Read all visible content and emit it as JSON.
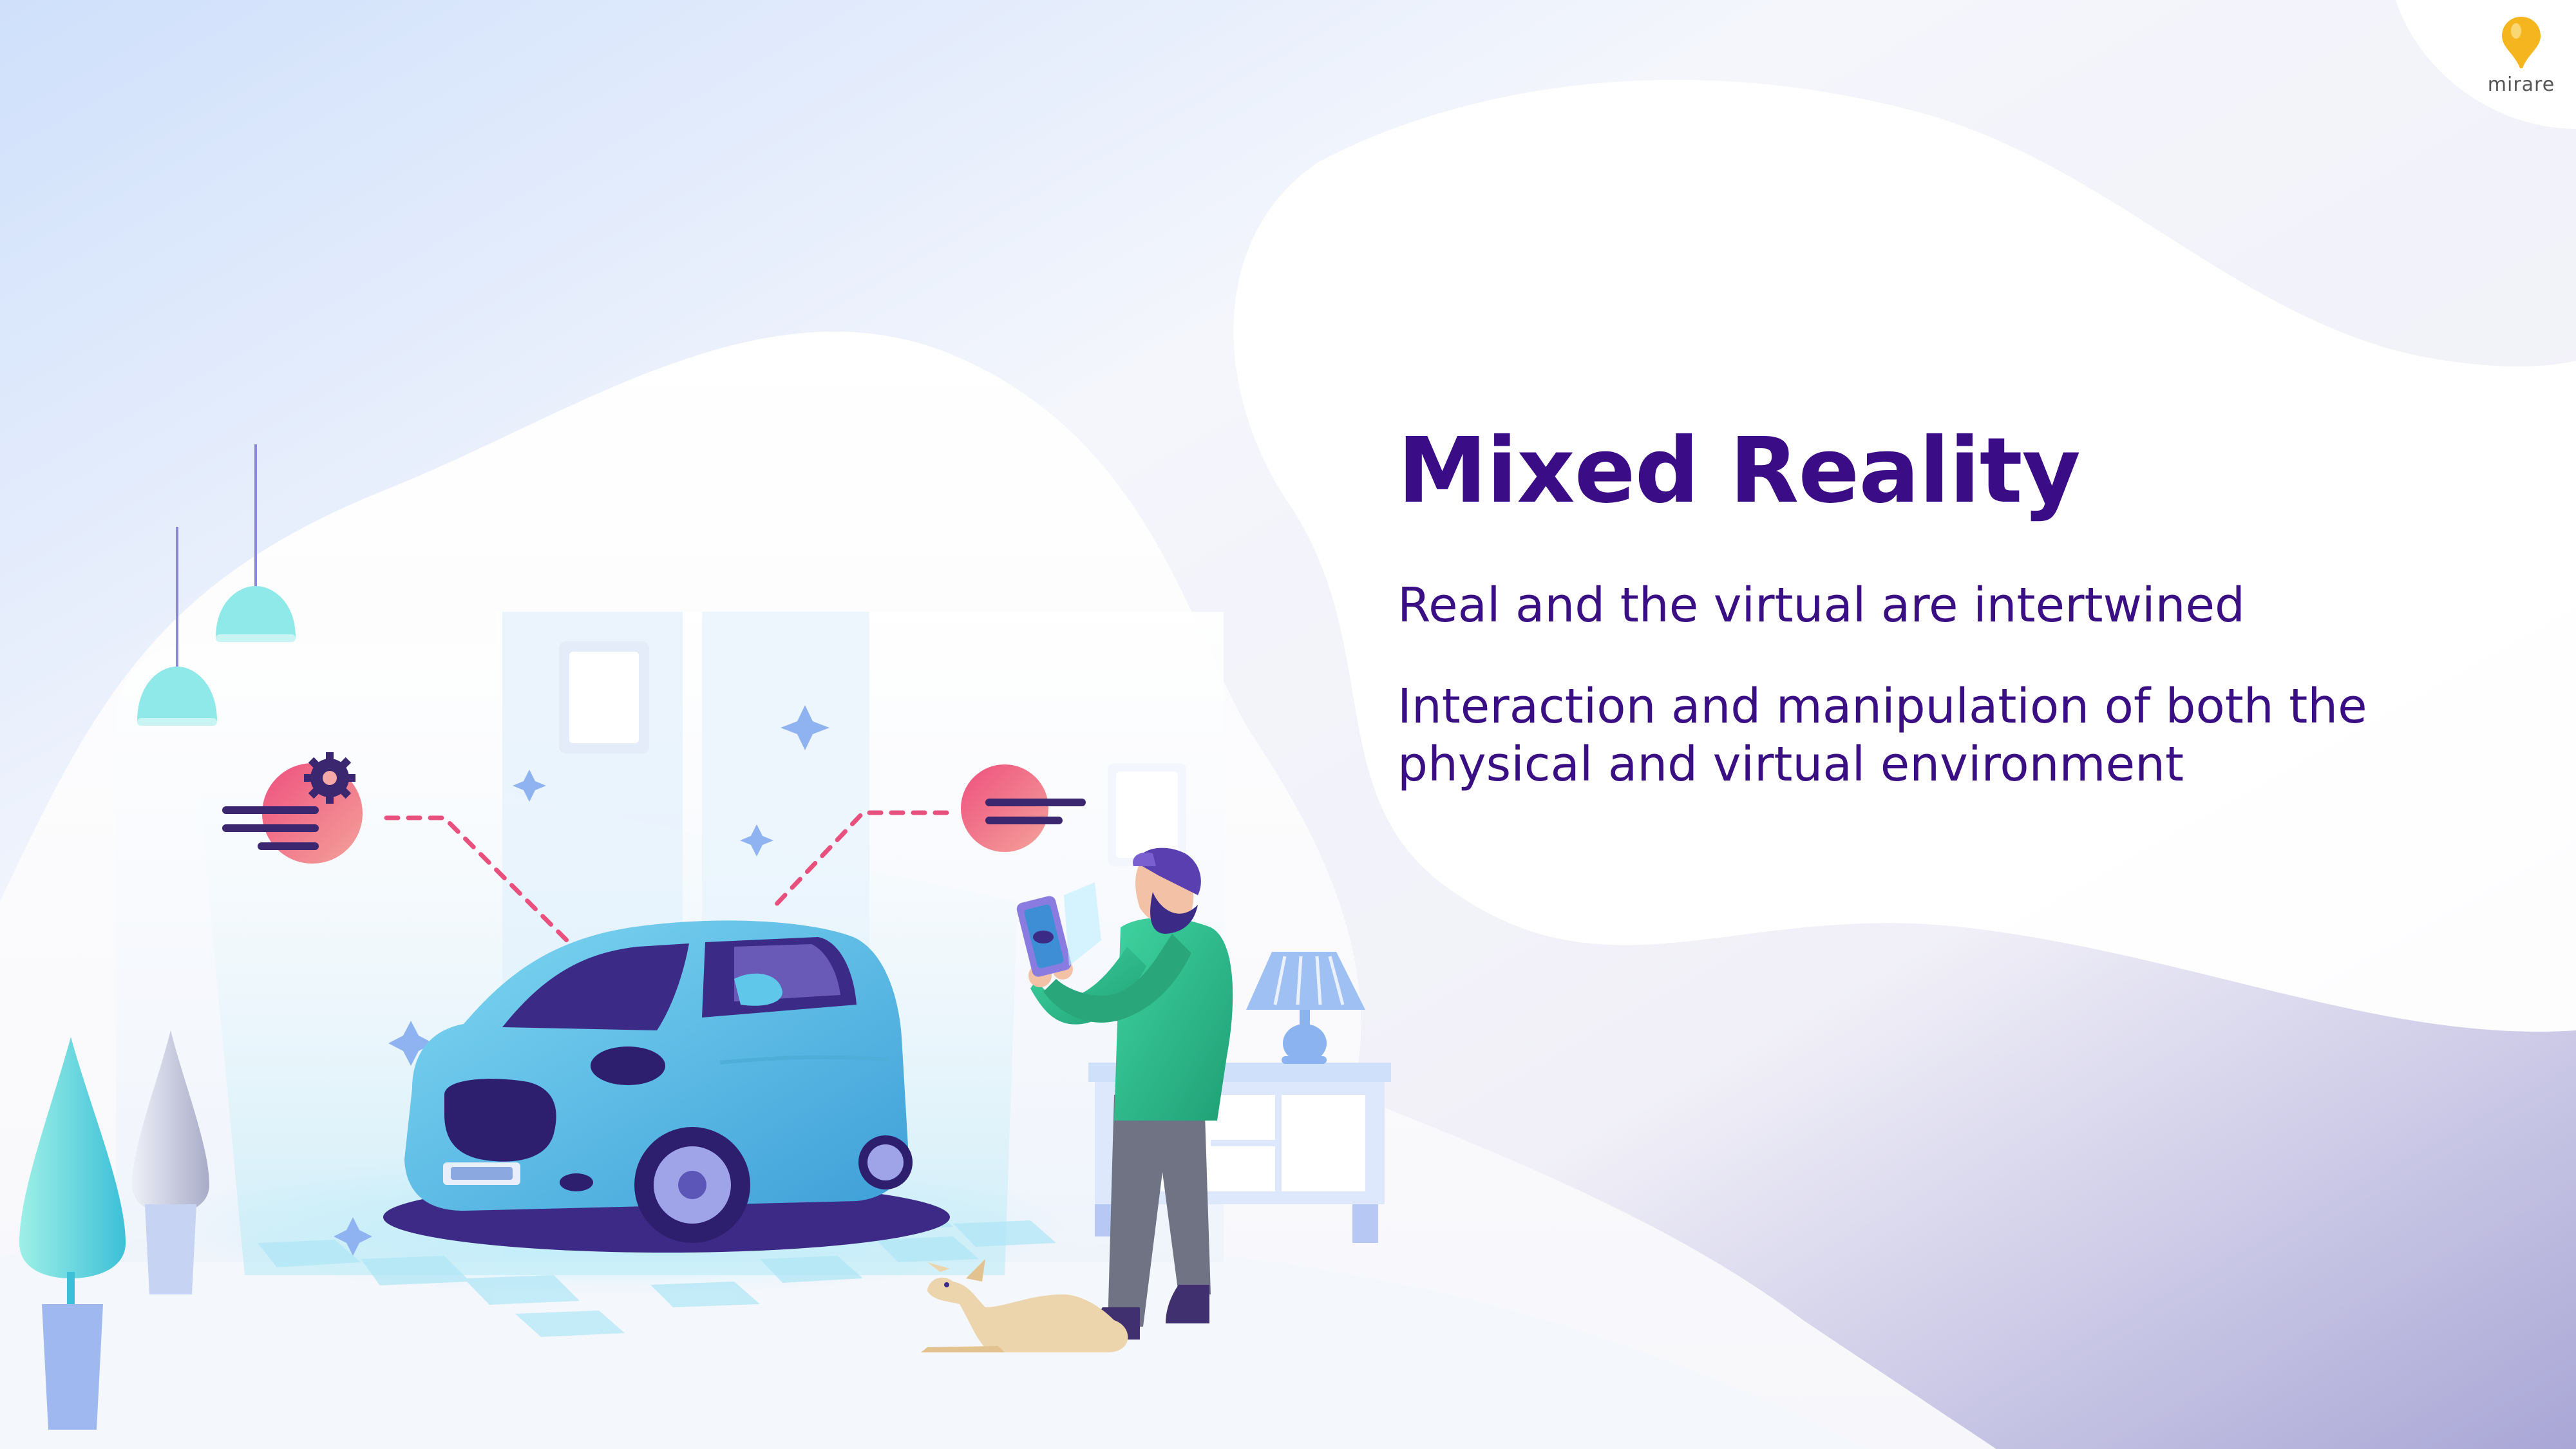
{
  "slide": {
    "title": "Mixed Reality",
    "points": [
      "Real and the virtual are intertwined",
      "Interaction and manipulation of both the physical and virtual environment"
    ]
  },
  "logo": {
    "text": "mirare",
    "icon": "pin-bulb-icon",
    "accent": "#f5b51f"
  },
  "illustration": {
    "subject": "person-with-tablet-scanning-car",
    "icons": [
      "car-icon",
      "person-icon",
      "tablet-icon",
      "dog-icon",
      "lamp-icon",
      "plant-icon",
      "sparkle-icon",
      "gear-icon"
    ]
  },
  "colors": {
    "title": "#3a0c85",
    "text": "#3b0f84",
    "car": "#5fc7ea",
    "shirt": "#2fbf8a",
    "badge": "#e8507e"
  }
}
